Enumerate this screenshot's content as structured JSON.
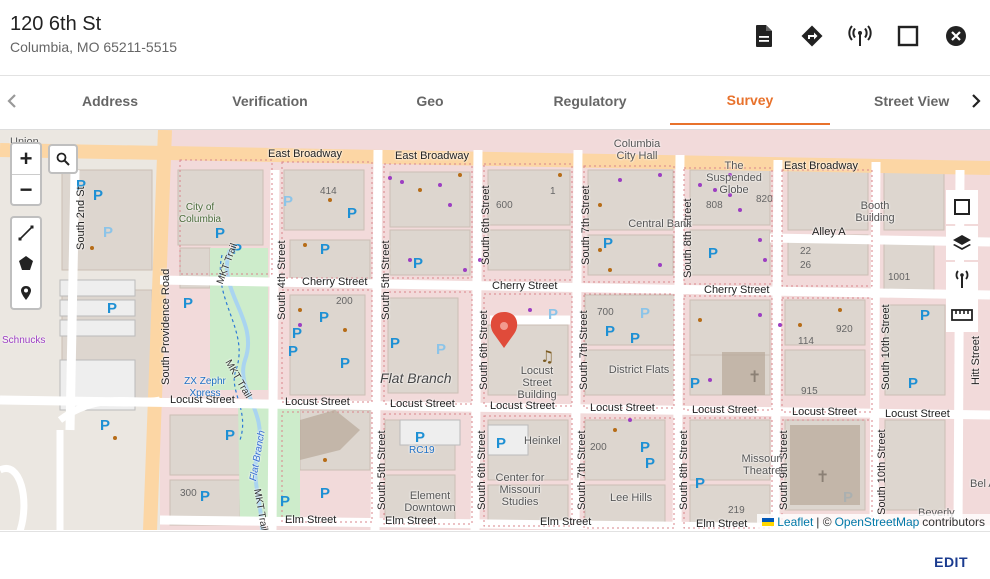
{
  "header": {
    "title": "120 6th St",
    "subtitle": "Columbia, MO 65211-5515",
    "icons": [
      "document-icon",
      "directions-icon",
      "antenna-icon",
      "square-icon",
      "close-circle-icon"
    ]
  },
  "tabs": {
    "items": [
      {
        "label": "Address"
      },
      {
        "label": "Verification"
      },
      {
        "label": "Geo"
      },
      {
        "label": "Regulatory"
      },
      {
        "label": "Survey"
      },
      {
        "label": "Street View"
      }
    ],
    "active": "Survey",
    "accent_color": "#e8722c"
  },
  "map": {
    "zoom_in": "+",
    "zoom_out": "−",
    "marker_color": "#e04b3a",
    "streets": {
      "east_broadway_1": "East Broadway",
      "east_broadway_2": "East Broadway",
      "east_broadway_3": "East Broadway",
      "cherry_1": "Cherry Street",
      "cherry_2": "Cherry Street",
      "cherry_3": "Cherry Street",
      "locust_1": "Locust Street",
      "locust_2": "Locust Street",
      "locust_3": "Locust Street",
      "locust_4": "Locust Street",
      "locust_5": "Locust Street",
      "locust_6": "Locust Street",
      "locust_7": "Locust Street",
      "locust_8": "Locust Street",
      "elm_1": "Elm Street",
      "elm_2": "Elm Street",
      "elm_3": "Elm Street",
      "elm_4": "Elm Street",
      "alley_a": "Alley A",
      "providence": "South Providence Road",
      "s2nd": "South 2nd St",
      "s4th": "South 4th Street",
      "s5th_1": "South 5th Street",
      "s5th_2": "South 5th Street",
      "s6th_1": "South 6th Street",
      "s6th_2": "South 6th Street",
      "s6th_3": "South 6th Street",
      "s7th_1": "South 7th Street",
      "s7th_2": "South 7th Street",
      "s7th_3": "South 7th Street",
      "s8th_1": "South 8th Street",
      "s8th_2": "South 8th Street",
      "s9th": "South 9th Street",
      "s10th_1": "South 10th Street",
      "s10th_2": "South 10th Street",
      "hitt": "Hitt Street",
      "mkt_1": "MKT Trail",
      "mkt_2": "MKT Trail",
      "mkt_3": "MKT Trail"
    },
    "places": {
      "union": "Union",
      "columbia_city_hall": "Columbia City Hall",
      "suspended_globe": "The Suspended Globe",
      "city_of_columbia": "City of Columbia",
      "booth_building": "Booth Building",
      "central_bank": "Central Bank",
      "schnucks": "Schnucks",
      "flat_branch_1": "Flat Branch",
      "flat_branch_2": "Flat Branch",
      "locust_street_building": "Locust Street Building",
      "district_flats": "District Flats",
      "zx_zephr": "ZX Zephr Xpress",
      "heinkel": "Heinkel",
      "missouri_theatre": "Missouri Theatre",
      "rc19": "RC19",
      "element_downtown": "Element Downtown",
      "center_missouri_studies": "Center for Missouri Studies",
      "lee_hills": "Lee Hills",
      "bel_apart": "Bel Apar",
      "beverly": "Beverly"
    },
    "numbers": [
      "414",
      "600",
      "1",
      "808",
      "820",
      "22",
      "26",
      "1001",
      "200",
      "700",
      "920",
      "114",
      "915",
      "200",
      "300",
      "219"
    ],
    "attribution": {
      "leaflet": "Leaflet",
      "sep": "| ©",
      "osm": "OpenStreetMap",
      "contributors": "contributors"
    }
  },
  "footer": {
    "edit_label": "EDIT"
  }
}
